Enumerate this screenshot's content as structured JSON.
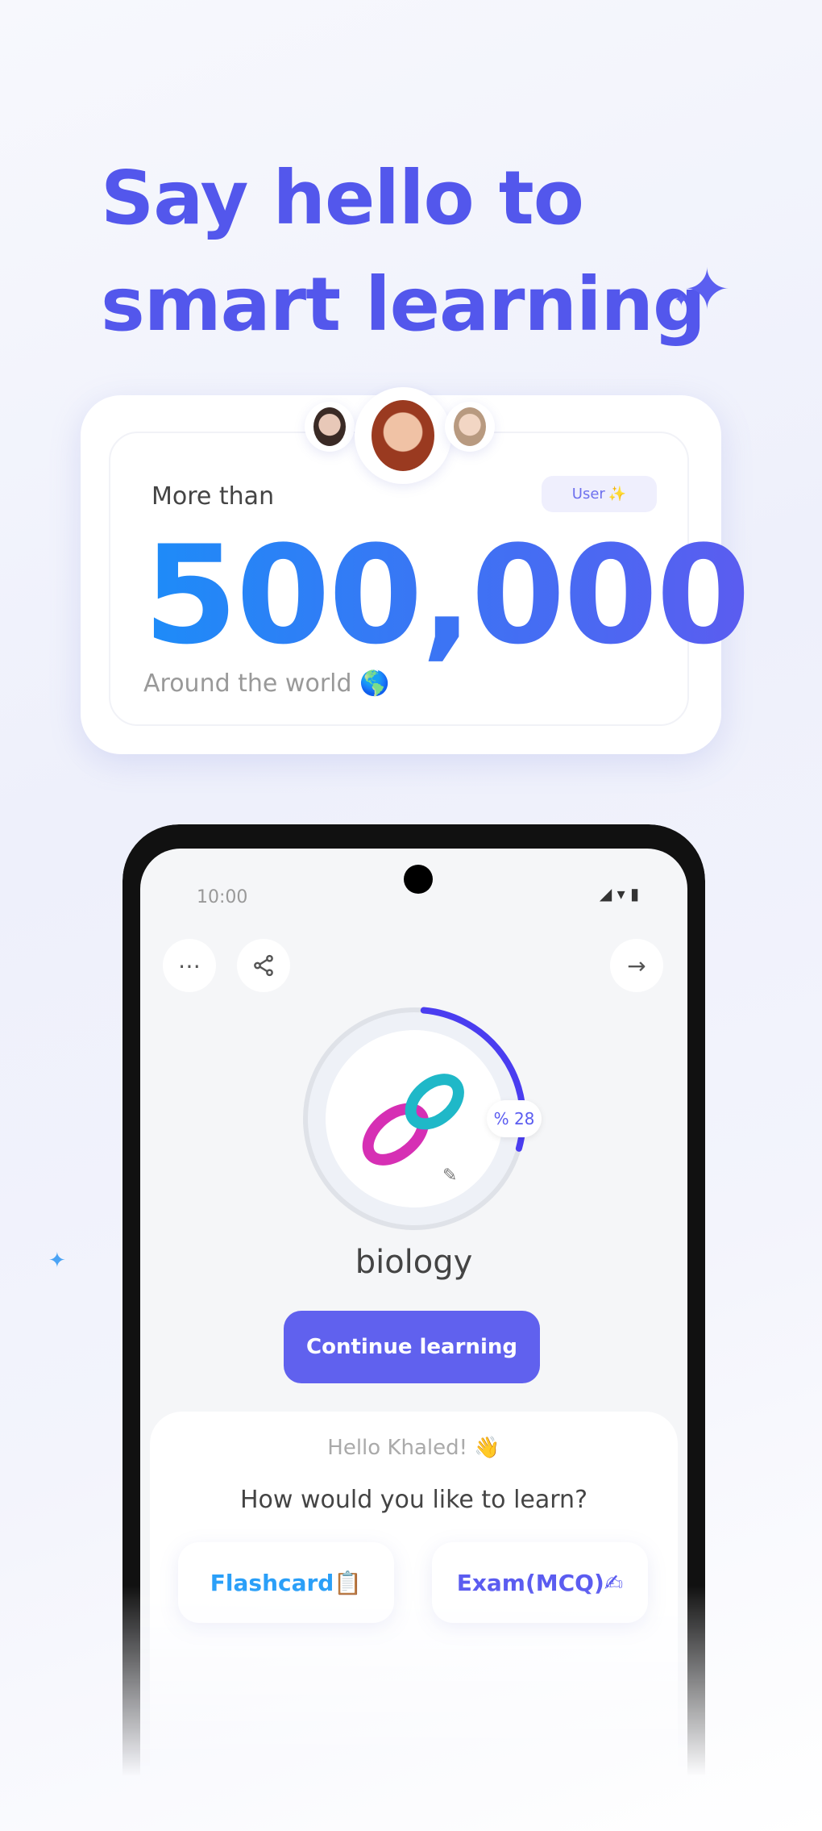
{
  "headline": {
    "line1": "Say hello to",
    "line2": "smart learning"
  },
  "stats_card": {
    "prefix": "More than",
    "badge": "User",
    "badge_icon": "✨",
    "number": "500,000",
    "suffix": "Around the world",
    "suffix_icon": "🌎"
  },
  "phone": {
    "status_time": "10:00",
    "status_icons": "◢ ▾ ▮",
    "subject": "biology",
    "progress_label": "% 28",
    "progress_percent": 28,
    "continue_label": "Continue learning",
    "greeting": "Hello Khaled! 👋",
    "question": "How would you like to learn?",
    "options": [
      {
        "label": "Flashcard",
        "icon": "📋"
      },
      {
        "label": "Exam(MCQ)",
        "icon": "✍"
      }
    ]
  },
  "colors": {
    "accent": "#5357ec",
    "button": "#6061ee",
    "flashcard": "#2a9ff8",
    "exam": "#5b5cf0"
  }
}
